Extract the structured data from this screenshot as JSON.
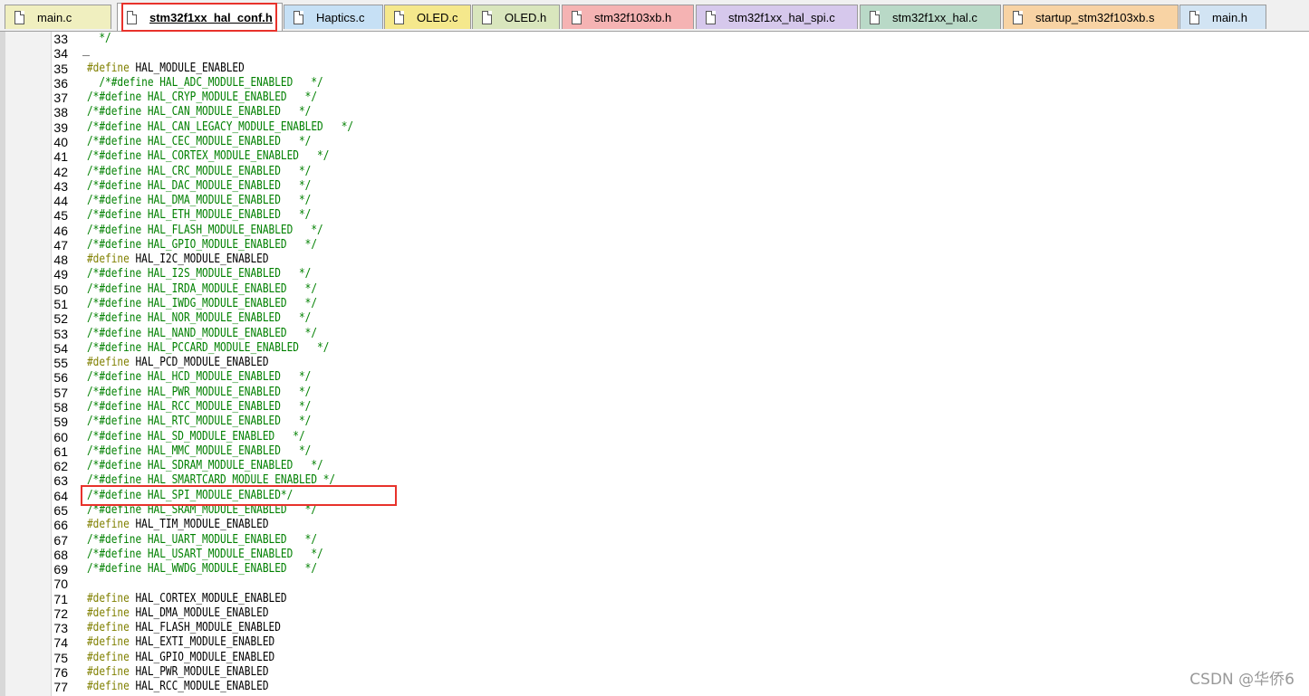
{
  "tabs": [
    {
      "label": "main.c",
      "color": "#f0efbf",
      "active": false
    },
    {
      "label": "stm32f1xx_hal_conf.h",
      "color": "#ffffff",
      "active": true
    },
    {
      "label": "Haptics.c",
      "color": "#c6e0f5",
      "active": false
    },
    {
      "label": "OLED.c",
      "color": "#f5e88c",
      "active": false
    },
    {
      "label": "OLED.h",
      "color": "#d9e6bd",
      "active": false
    },
    {
      "label": "stm32f103xb.h",
      "color": "#f5b3b3",
      "active": false
    },
    {
      "label": "stm32f1xx_hal_spi.c",
      "color": "#d6c8ec",
      "active": false
    },
    {
      "label": "stm32f1xx_hal.c",
      "color": "#b9d9c7",
      "active": false
    },
    {
      "label": "startup_stm32f103xb.s",
      "color": "#f8d3a4",
      "active": false
    },
    {
      "label": "main.h",
      "color": "#d2e4f3",
      "active": false
    }
  ],
  "lines": [
    {
      "num": "33",
      "text": "  */",
      "kind": "comment"
    },
    {
      "num": "34",
      "text": "",
      "kind": "plain"
    },
    {
      "num": "35",
      "pp": "#define",
      "text": " HAL_MODULE_ENABLED",
      "kind": "define"
    },
    {
      "num": "36",
      "text": "  /*#define HAL_ADC_MODULE_ENABLED   */",
      "kind": "comment"
    },
    {
      "num": "37",
      "text": "/*#define HAL_CRYP_MODULE_ENABLED   */",
      "kind": "comment"
    },
    {
      "num": "38",
      "text": "/*#define HAL_CAN_MODULE_ENABLED   */",
      "kind": "comment"
    },
    {
      "num": "39",
      "text": "/*#define HAL_CAN_LEGACY_MODULE_ENABLED   */",
      "kind": "comment"
    },
    {
      "num": "40",
      "text": "/*#define HAL_CEC_MODULE_ENABLED   */",
      "kind": "comment"
    },
    {
      "num": "41",
      "text": "/*#define HAL_CORTEX_MODULE_ENABLED   */",
      "kind": "comment"
    },
    {
      "num": "42",
      "text": "/*#define HAL_CRC_MODULE_ENABLED   */",
      "kind": "comment"
    },
    {
      "num": "43",
      "text": "/*#define HAL_DAC_MODULE_ENABLED   */",
      "kind": "comment"
    },
    {
      "num": "44",
      "text": "/*#define HAL_DMA_MODULE_ENABLED   */",
      "kind": "comment"
    },
    {
      "num": "45",
      "text": "/*#define HAL_ETH_MODULE_ENABLED   */",
      "kind": "comment"
    },
    {
      "num": "46",
      "text": "/*#define HAL_FLASH_MODULE_ENABLED   */",
      "kind": "comment"
    },
    {
      "num": "47",
      "text": "/*#define HAL_GPIO_MODULE_ENABLED   */",
      "kind": "comment"
    },
    {
      "num": "48",
      "pp": "#define",
      "text": " HAL_I2C_MODULE_ENABLED",
      "kind": "define"
    },
    {
      "num": "49",
      "text": "/*#define HAL_I2S_MODULE_ENABLED   */",
      "kind": "comment"
    },
    {
      "num": "50",
      "text": "/*#define HAL_IRDA_MODULE_ENABLED   */",
      "kind": "comment"
    },
    {
      "num": "51",
      "text": "/*#define HAL_IWDG_MODULE_ENABLED   */",
      "kind": "comment"
    },
    {
      "num": "52",
      "text": "/*#define HAL_NOR_MODULE_ENABLED   */",
      "kind": "comment"
    },
    {
      "num": "53",
      "text": "/*#define HAL_NAND_MODULE_ENABLED   */",
      "kind": "comment"
    },
    {
      "num": "54",
      "text": "/*#define HAL_PCCARD_MODULE_ENABLED   */",
      "kind": "comment"
    },
    {
      "num": "55",
      "pp": "#define",
      "text": " HAL_PCD_MODULE_ENABLED",
      "kind": "define"
    },
    {
      "num": "56",
      "text": "/*#define HAL_HCD_MODULE_ENABLED   */",
      "kind": "comment"
    },
    {
      "num": "57",
      "text": "/*#define HAL_PWR_MODULE_ENABLED   */",
      "kind": "comment"
    },
    {
      "num": "58",
      "text": "/*#define HAL_RCC_MODULE_ENABLED   */",
      "kind": "comment"
    },
    {
      "num": "59",
      "text": "/*#define HAL_RTC_MODULE_ENABLED   */",
      "kind": "comment"
    },
    {
      "num": "60",
      "text": "/*#define HAL_SD_MODULE_ENABLED   */",
      "kind": "comment"
    },
    {
      "num": "61",
      "text": "/*#define HAL_MMC_MODULE_ENABLED   */",
      "kind": "comment"
    },
    {
      "num": "62",
      "text": "/*#define HAL_SDRAM_MODULE_ENABLED   */",
      "kind": "comment"
    },
    {
      "num": "63",
      "text": "/*#define HAL_SMARTCARD_MODULE_ENABLED */",
      "kind": "comment"
    },
    {
      "num": "64",
      "text": "/*#define HAL_SPI_MODULE_ENABLED*/",
      "kind": "comment"
    },
    {
      "num": "65",
      "text": "/*#define HAL_SRAM_MODULE_ENABLED   */",
      "kind": "comment"
    },
    {
      "num": "66",
      "pp": "#define",
      "text": " HAL_TIM_MODULE_ENABLED",
      "kind": "define"
    },
    {
      "num": "67",
      "text": "/*#define HAL_UART_MODULE_ENABLED   */",
      "kind": "comment"
    },
    {
      "num": "68",
      "text": "/*#define HAL_USART_MODULE_ENABLED   */",
      "kind": "comment"
    },
    {
      "num": "69",
      "text": "/*#define HAL_WWDG_MODULE_ENABLED   */",
      "kind": "comment"
    },
    {
      "num": "70",
      "text": "",
      "kind": "plain"
    },
    {
      "num": "71",
      "pp": "#define",
      "text": " HAL_CORTEX_MODULE_ENABLED",
      "kind": "define"
    },
    {
      "num": "72",
      "pp": "#define",
      "text": " HAL_DMA_MODULE_ENABLED",
      "kind": "define"
    },
    {
      "num": "73",
      "pp": "#define",
      "text": " HAL_FLASH_MODULE_ENABLED",
      "kind": "define"
    },
    {
      "num": "74",
      "pp": "#define",
      "text": " HAL_EXTI_MODULE_ENABLED",
      "kind": "define"
    },
    {
      "num": "75",
      "pp": "#define",
      "text": " HAL_GPIO_MODULE_ENABLED",
      "kind": "define"
    },
    {
      "num": "76",
      "pp": "#define",
      "text": " HAL_PWR_MODULE_ENABLED",
      "kind": "define"
    },
    {
      "num": "77",
      "pp": "#define",
      "text": " HAL_RCC_MODULE_ENABLED",
      "kind": "define"
    }
  ],
  "watermark": "CSDN @华侨6",
  "colors": {
    "comment": "#008000",
    "preprocessor": "#808000",
    "highlight": "#e8322b"
  }
}
